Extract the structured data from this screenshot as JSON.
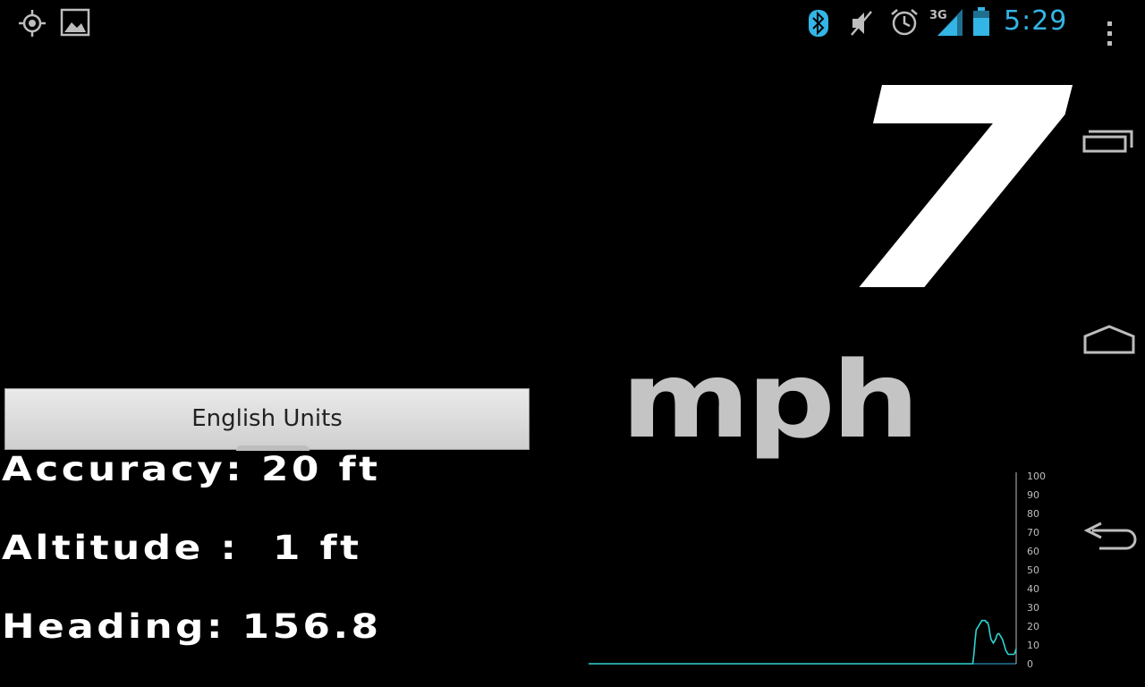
{
  "status_bar": {
    "time": "5:29",
    "network": "3G",
    "icons": [
      "gps-icon",
      "gallery-icon",
      "bluetooth-icon",
      "mute-icon",
      "alarm-icon",
      "signal-icon",
      "battery-icon"
    ],
    "accent_color": "#33b5e5"
  },
  "speedometer": {
    "speed": "7",
    "unit": "mph"
  },
  "units_button": {
    "label": "English Units"
  },
  "info": {
    "accuracy": "Accuracy: 20 ft",
    "altitude": "Altitude :  1 ft",
    "heading": "Heading: 156.8"
  },
  "nav": {
    "menu_icon": "overflow-menu-icon",
    "recent_icon": "recent-apps-icon",
    "home_icon": "home-icon",
    "back_icon": "back-icon"
  },
  "chart_data": {
    "type": "line",
    "ylim": [
      0,
      100
    ],
    "y_ticks": [
      "100",
      "90",
      "80",
      "70",
      "60",
      "50",
      "40",
      "30",
      "20",
      "10",
      "0"
    ],
    "series_color": "#2fd3d3",
    "values": [
      0,
      0,
      0,
      0,
      0,
      0,
      0,
      0,
      0,
      0,
      0,
      0,
      0,
      0,
      0,
      0,
      0,
      0,
      0,
      0,
      0,
      0,
      0,
      0,
      0,
      0,
      0,
      0,
      0,
      0,
      0,
      0,
      0,
      0,
      0,
      0,
      0,
      0,
      0,
      0,
      0,
      0,
      0,
      0,
      0,
      0,
      0,
      0,
      0,
      0,
      0,
      0,
      0,
      0,
      0,
      0,
      0,
      0,
      0,
      0,
      0,
      0,
      0,
      0,
      0,
      0,
      0,
      0,
      0,
      0,
      0,
      0,
      0,
      0,
      0,
      0,
      0,
      0,
      0,
      0,
      0,
      0,
      0,
      0,
      0,
      0,
      0,
      0,
      0,
      0,
      0,
      0,
      0,
      0,
      0,
      0,
      0,
      0,
      0,
      0,
      0,
      0,
      0,
      0,
      0,
      0,
      0,
      0,
      0,
      0,
      0,
      0,
      0,
      0,
      0,
      0,
      0,
      0,
      0,
      0,
      0,
      0,
      0,
      0,
      0,
      0,
      0,
      0,
      0,
      0,
      0,
      0,
      0,
      0,
      0,
      0,
      0,
      0,
      0,
      0,
      0,
      0,
      0,
      0,
      0,
      0,
      0,
      0,
      0,
      0,
      0,
      0,
      0,
      0,
      0,
      0,
      0,
      0,
      0,
      0,
      0,
      0,
      0,
      0,
      0,
      0,
      0,
      0,
      0,
      0,
      0,
      0,
      0,
      0,
      0,
      0,
      0,
      0,
      0,
      0,
      0,
      0,
      0,
      0,
      0,
      0,
      0,
      0,
      0,
      0,
      0,
      0,
      0,
      0,
      0,
      0,
      0,
      0,
      0,
      0,
      0,
      0,
      0,
      0,
      0,
      0,
      0,
      0,
      0,
      0,
      0,
      0,
      0,
      0,
      0,
      0,
      0,
      0,
      0,
      0,
      0,
      0,
      0,
      0,
      0,
      0,
      0,
      0,
      0,
      0,
      0,
      0,
      0,
      0,
      0,
      0,
      0,
      0,
      0,
      0,
      0,
      0,
      0,
      0,
      0,
      0,
      0,
      0,
      0,
      0,
      0,
      0,
      0,
      0,
      0,
      0,
      0,
      0,
      0,
      0,
      0,
      0,
      0,
      0,
      0,
      0,
      0,
      0,
      0,
      0,
      0,
      0,
      0,
      0,
      0,
      0,
      0,
      0,
      0,
      0,
      0,
      0,
      0,
      0,
      0,
      0,
      0,
      0,
      0,
      0,
      0,
      0,
      0,
      0,
      0,
      0,
      0,
      0,
      0,
      0,
      0,
      0,
      0,
      0,
      0,
      0,
      0,
      0,
      0,
      0,
      0,
      0,
      0,
      0,
      0,
      0,
      0,
      0,
      0,
      0,
      0,
      0,
      0,
      0,
      0,
      0,
      0,
      0,
      0,
      0,
      0,
      0,
      0,
      0,
      0,
      0,
      0,
      5,
      12,
      18,
      19,
      20,
      21,
      22,
      23,
      23,
      23,
      23,
      22,
      22,
      20,
      16,
      13,
      12,
      11,
      12,
      13,
      15,
      16,
      16,
      15,
      14,
      13,
      11,
      9,
      7,
      6,
      5,
      5,
      5,
      5,
      5,
      5,
      6,
      8
    ]
  }
}
